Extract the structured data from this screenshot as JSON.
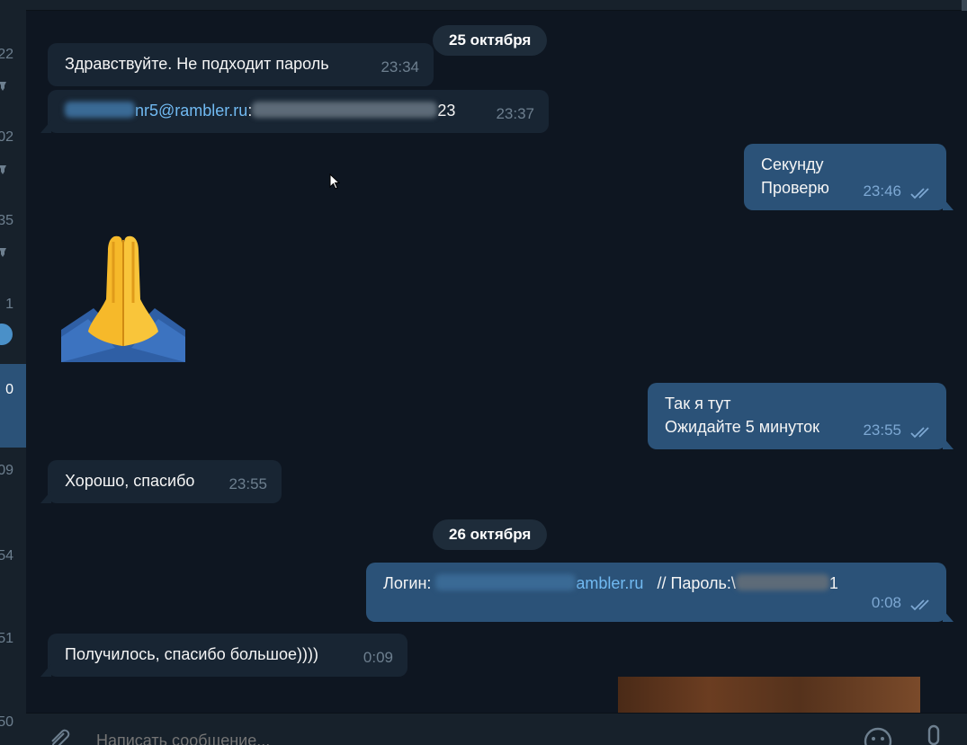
{
  "sidebar": {
    "numbers": [
      "22",
      "02",
      "35",
      "1",
      "0",
      "09",
      "54",
      "51",
      "50"
    ]
  },
  "dates": {
    "first": "25 октября",
    "second": "26 октября"
  },
  "messages": [
    {
      "dir": "in",
      "text": "Здравствуйте. Не подходит пароль",
      "time": "23:34"
    },
    {
      "dir": "in",
      "link_suffix": "nr5@rambler.ru",
      "sep": ":",
      "tail": "23",
      "time": "23:37"
    },
    {
      "dir": "out",
      "line1": "Секунду",
      "line2": "Проверю",
      "time": "23:46"
    },
    {
      "dir": "out",
      "line1": "Так я тут",
      "line2": "Ожидайте 5 минуток",
      "time": "23:55"
    },
    {
      "dir": "in",
      "text": "Хорошо, спасибо",
      "time": "23:55"
    },
    {
      "dir": "out",
      "login_label": "Логин: ",
      "login_link_suffix": "ambler.ru",
      "pass_label": "   // Пароль:\\",
      "pass_tail": "1",
      "time": "0:08"
    },
    {
      "dir": "in",
      "text": "Получилось, спасибо большое))))",
      "time": "0:09"
    }
  ],
  "composer": {
    "placeholder": "Написать сообщение..."
  },
  "colors": {
    "background": "#0e1621",
    "incoming": "#182533",
    "outgoing": "#2b5278",
    "link": "#71baf2",
    "time": "#6d7f8f"
  },
  "icons": [
    "pin-icon",
    "praying-hands-sticker",
    "double-check-icon",
    "attach-icon",
    "emoji-icon",
    "mic-icon",
    "cursor-icon"
  ]
}
